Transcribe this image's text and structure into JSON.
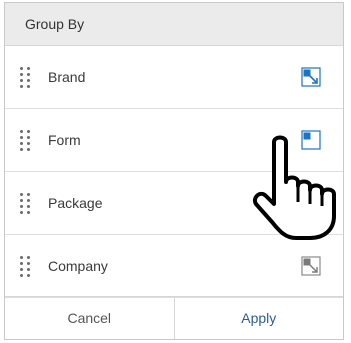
{
  "panel": {
    "title": "Group By",
    "items": [
      {
        "label": "Brand",
        "toggle_state": "active"
      },
      {
        "label": "Form",
        "toggle_state": "active"
      },
      {
        "label": "Package",
        "toggle_state": "hidden-by-cursor"
      },
      {
        "label": "Company",
        "toggle_state": "inactive"
      }
    ]
  },
  "footer": {
    "cancel_label": "Cancel",
    "apply_label": "Apply"
  },
  "colors": {
    "toggle_active": "#1a73c8",
    "toggle_inactive": "#7a7a7a",
    "apply_text": "#2b5c9a",
    "header_bg": "#ebebeb"
  },
  "icons": {
    "drag": "drag-handle-icon",
    "toggle": "expand-toggle-icon",
    "cursor": "hand-pointer-icon"
  }
}
